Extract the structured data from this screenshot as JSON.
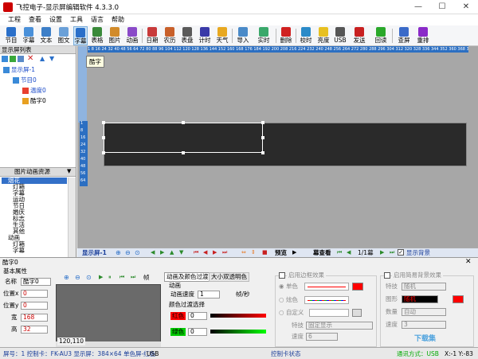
{
  "window": {
    "title": "飞控电子-显示屏编辑软件 4.3.3.0",
    "minimize": "—",
    "maximize": "☐",
    "close": "✕"
  },
  "menu": [
    "工程",
    "查看",
    "设置",
    "工具",
    "语言",
    "帮助"
  ],
  "toolbar": [
    {
      "label": "节目",
      "icon": "program-icon",
      "color": "#2a6fc9"
    },
    {
      "label": "字幕",
      "icon": "subtitle-icon",
      "color": "#4a90d9"
    },
    {
      "label": "文本",
      "icon": "text-icon",
      "color": "#3d7fc8"
    },
    {
      "label": "图文",
      "icon": "image-text-icon",
      "color": "#6aa0d8"
    },
    {
      "label": "字幕",
      "icon": "caption-icon",
      "color": "#2a6fc9",
      "active": true
    },
    {
      "label": "表格",
      "icon": "table-icon",
      "color": "#3a8a3a"
    },
    {
      "label": "图片",
      "icon": "picture-icon",
      "color": "#d28b2a"
    },
    {
      "label": "动画",
      "icon": "animation-icon",
      "color": "#8a4ac8"
    },
    {
      "label": "日期",
      "icon": "date-icon",
      "color": "#c83a3a"
    },
    {
      "label": "农历",
      "icon": "lunar-icon",
      "color": "#c8602a"
    },
    {
      "label": "表盘",
      "icon": "clock-dial-icon",
      "color": "#5a5a5a"
    },
    {
      "label": "计时",
      "icon": "timer-icon",
      "color": "#3a3aa8"
    },
    {
      "label": "天气",
      "icon": "weather-icon",
      "color": "#e8a820"
    },
    {
      "label": "导入",
      "icon": "import-icon",
      "color": "#4a8ac8"
    },
    {
      "label": "实时",
      "icon": "realtime-icon",
      "color": "#3aa86a"
    },
    {
      "label": "删除",
      "icon": "delete-icon",
      "color": "#d02020"
    },
    {
      "label": "校时",
      "icon": "sync-time-icon",
      "color": "#2a8ac8"
    },
    {
      "label": "亮度",
      "icon": "brightness-icon",
      "color": "#e8c020"
    },
    {
      "label": "USB",
      "icon": "usb-icon",
      "color": "#555555"
    },
    {
      "label": "发送",
      "icon": "send-icon",
      "color": "#c82020"
    },
    {
      "label": "回读",
      "icon": "readback-icon",
      "color": "#2aa82a"
    },
    {
      "label": "查屏",
      "icon": "find-screen-icon",
      "color": "#3a6ac8"
    },
    {
      "label": "重排",
      "icon": "rearrange-icon",
      "color": "#8a2ac8"
    }
  ],
  "left_panel": {
    "title": "显示屏列表",
    "tree": [
      {
        "label": "显示屏-1",
        "level": 0,
        "color": "#1a4ac8"
      },
      {
        "label": "节目0",
        "level": 1,
        "color": "#1a4ac8"
      },
      {
        "label": "温度0",
        "level": 2,
        "color": "#1a4ac8"
      },
      {
        "label": "酷字0",
        "level": 2,
        "color": "#000000"
      }
    ],
    "resource_title": "图片动画资源",
    "resources": [
      {
        "label": "烟花",
        "level": 0,
        "selected": true
      },
      {
        "label": "灯箱",
        "level": 1
      },
      {
        "label": "字幕",
        "level": 1
      },
      {
        "label": "运动",
        "level": 1
      },
      {
        "label": "节日",
        "level": 1
      },
      {
        "label": "婚庆",
        "level": 1
      },
      {
        "label": "标志",
        "level": 1
      },
      {
        "label": "生活",
        "level": 1
      },
      {
        "label": "其他",
        "level": 1
      },
      {
        "label": "动画",
        "level": 0
      },
      {
        "label": "灯箱",
        "level": 1
      },
      {
        "label": "字幕",
        "level": 1
      }
    ]
  },
  "canvas": {
    "tooltip": "酷字",
    "ruler_top": "1 8 16 24 32 40 48 56 64 72 80 88 96 104 112 120 128 136 144 152 160 168 176 184 192 200 208 216 224 232 240 248 256 264 272 280 288 296 304 312 320 328 336 344 352 360 368 376 384",
    "ruler_left": [
      "1",
      "8",
      "16",
      "24",
      "32",
      "40",
      "48",
      "56",
      "64"
    ]
  },
  "navbar": {
    "screen": "显示屏-1",
    "preview": "预览",
    "view": "幕查看",
    "page": "1/1幕",
    "show_bg": "显示背景"
  },
  "bottom": {
    "title": "酷字0",
    "basic_title": "基本属性",
    "name_label": "名称",
    "name_value": "酷字0",
    "x_label": "位置x",
    "x_value": "0",
    "y_label": "位置y",
    "y_value": "0",
    "w_label": "宽",
    "w_value": "168",
    "h_label": "高",
    "h_value": "32",
    "frame_label": "帧",
    "coord": "120,110",
    "tab1": "动画及颜色过渡",
    "tab2": "大小双透明色",
    "anim_label": "动画",
    "speed_label": "动画速度",
    "speed_value": "1",
    "speed_unit": "帧/秒",
    "color_label": "颜色过渡选择",
    "red_label": "红色",
    "red_value": "0",
    "green_label": "绿色",
    "green_value": "0",
    "border_title": "启用边框效果",
    "single_label": "单色",
    "multi_label": "炫色",
    "custom_label": "自定义",
    "fx_label": "特技",
    "fx_value": "固定显示",
    "spd_label": "速度",
    "spd_value": "6",
    "simple_bg_title": "启用简易背景效果",
    "fx2_label": "特技",
    "fx2_value": "随机",
    "shape_label": "图形",
    "shape_value": "随机",
    "count_label": "数量",
    "count_value": "自动",
    "speed2_label": "速度",
    "speed2_value": "3",
    "accent_red": "#ff0000"
  },
  "status": {
    "left": "屏号：1 控制卡：FK-AU3 显示屏：384×64 单色屏-红色",
    "usb": "USB",
    "state": "控制卡状态",
    "comm": "通讯方式：USB",
    "pos": "X:-1 Y:-83"
  },
  "watermark": "下载集"
}
